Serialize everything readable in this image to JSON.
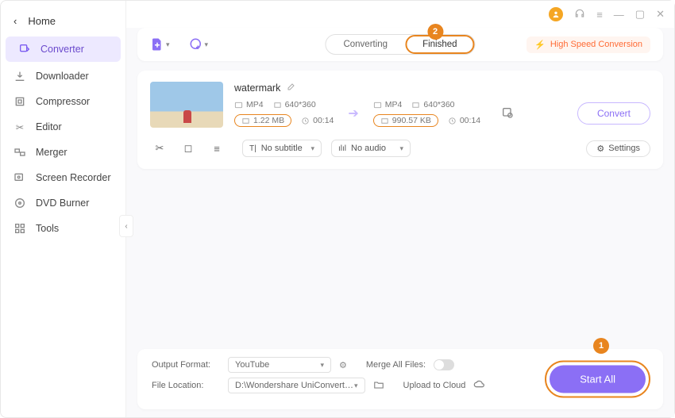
{
  "home_label": "Home",
  "sidebar": {
    "items": [
      {
        "label": "Converter"
      },
      {
        "label": "Downloader"
      },
      {
        "label": "Compressor"
      },
      {
        "label": "Editor"
      },
      {
        "label": "Merger"
      },
      {
        "label": "Screen Recorder"
      },
      {
        "label": "DVD Burner"
      },
      {
        "label": "Tools"
      }
    ]
  },
  "tabs": {
    "converting": "Converting",
    "finished": "Finished"
  },
  "hsc_label": "High Speed Conversion",
  "file": {
    "name": "watermark",
    "src": {
      "format": "MP4",
      "resolution": "640*360",
      "size": "1.22 MB",
      "duration": "00:14"
    },
    "dst": {
      "format": "MP4",
      "resolution": "640*360",
      "size": "990.57 KB",
      "duration": "00:14"
    }
  },
  "convert_label": "Convert",
  "subtitle_select": "No subtitle",
  "audio_select": "No audio",
  "settings_label": "Settings",
  "footer": {
    "output_format_label": "Output Format:",
    "output_format_value": "YouTube",
    "file_location_label": "File Location:",
    "file_location_value": "D:\\Wondershare UniConverter 1",
    "merge_label": "Merge All Files:",
    "upload_label": "Upload to Cloud"
  },
  "start_all_label": "Start All",
  "annotations": {
    "a1": "1",
    "a2": "2"
  }
}
